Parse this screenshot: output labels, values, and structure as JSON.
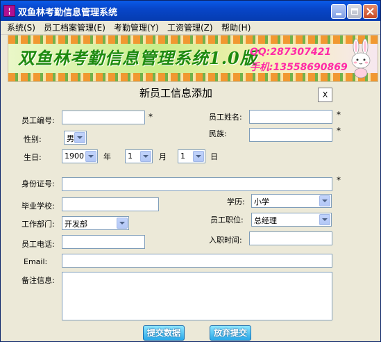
{
  "window": {
    "title": "双鱼林考勤信息管理系统",
    "icon_glyph": "¦"
  },
  "menu": [
    {
      "label": "系统(S)"
    },
    {
      "label": "员工档案管理(E)"
    },
    {
      "label": "考勤管理(Y)"
    },
    {
      "label": "工资管理(Z)"
    },
    {
      "label": "帮助(H)"
    }
  ],
  "banner": {
    "title": "双鱼林考勤信息管理系统1.0版",
    "qq": "QQ:287307421",
    "phone": "手机:13558690869"
  },
  "form": {
    "title": "新员工信息添加",
    "close_label": "X",
    "required_mark": "*",
    "employee_no": {
      "label": "员工编号:",
      "value": ""
    },
    "employee_name": {
      "label": "员工姓名:",
      "value": ""
    },
    "gender": {
      "label": "性别:",
      "value": "男"
    },
    "ethnicity": {
      "label": "民族:",
      "value": ""
    },
    "birthday": {
      "label": "生日:",
      "year": "1900",
      "year_unit": "年",
      "month": "1",
      "month_unit": "月",
      "day": "1",
      "day_unit": "日"
    },
    "id_card": {
      "label": "身份证号:",
      "value": ""
    },
    "school": {
      "label": "毕业学校:",
      "value": ""
    },
    "education": {
      "label": "学历:",
      "value": "小学"
    },
    "department": {
      "label": "工作部门:",
      "value": "开发部"
    },
    "position": {
      "label": "员工职位:",
      "value": "总经理"
    },
    "phone": {
      "label": "员工电话:",
      "value": ""
    },
    "hire_date": {
      "label": "入职时间:",
      "value": ""
    },
    "email": {
      "label": "Email:",
      "value": ""
    },
    "remark": {
      "label": "备注信息:",
      "value": ""
    },
    "submit_label": "提交数据",
    "cancel_label": "放弃提交"
  },
  "colors": {
    "titlebar": "#0746c9",
    "window_bg": "#ece9d8",
    "banner_title": "#1e8a10",
    "banner_contact": "#ff2aa6",
    "button": "#2aa8e8"
  }
}
